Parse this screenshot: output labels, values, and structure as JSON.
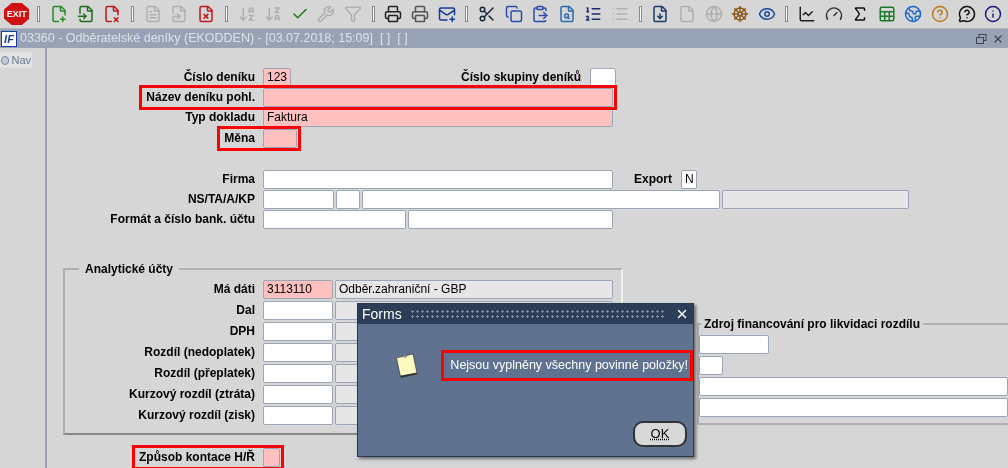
{
  "toolbar": [
    {
      "kind": "exit",
      "label": "EXIT",
      "disabled": false
    },
    {
      "kind": "separator"
    },
    {
      "kind": "button",
      "disabled": false
    },
    {
      "kind": "button",
      "disabled": false
    },
    {
      "kind": "button",
      "disabled": false
    },
    {
      "kind": "separator"
    },
    {
      "kind": "button",
      "disabled": true
    },
    {
      "kind": "button",
      "disabled": true
    },
    {
      "kind": "button",
      "disabled": false
    },
    {
      "kind": "separator"
    },
    {
      "kind": "button",
      "disabled": true
    },
    {
      "kind": "button",
      "disabled": true
    },
    {
      "kind": "button",
      "disabled": false
    },
    {
      "kind": "button",
      "disabled": true
    },
    {
      "kind": "button",
      "disabled": true
    },
    {
      "kind": "separator"
    },
    {
      "kind": "button",
      "disabled": false
    },
    {
      "kind": "button",
      "disabled": false
    },
    {
      "kind": "button",
      "disabled": false
    },
    {
      "kind": "separator"
    },
    {
      "kind": "button",
      "disabled": false
    },
    {
      "kind": "button",
      "disabled": false
    },
    {
      "kind": "button",
      "disabled": false
    },
    {
      "kind": "button",
      "disabled": false
    },
    {
      "kind": "button",
      "disabled": false
    },
    {
      "kind": "button",
      "disabled": true
    },
    {
      "kind": "separator"
    },
    {
      "kind": "button",
      "disabled": false
    },
    {
      "kind": "button",
      "disabled": true
    },
    {
      "kind": "button",
      "disabled": true
    },
    {
      "kind": "button",
      "disabled": false
    },
    {
      "kind": "button",
      "disabled": false
    },
    {
      "kind": "separator"
    },
    {
      "kind": "button",
      "disabled": false
    },
    {
      "kind": "button",
      "disabled": false
    },
    {
      "kind": "button",
      "disabled": false
    },
    {
      "kind": "button",
      "disabled": false
    },
    {
      "kind": "button",
      "disabled": false
    },
    {
      "kind": "button",
      "disabled": false
    },
    {
      "kind": "button",
      "disabled": false
    },
    {
      "kind": "button",
      "disabled": false
    }
  ],
  "window": {
    "logo": "IF",
    "title": "03360 - Odběratelské deníky (EKODDEN) - [03.07.2018; 15:09]  [ ]  [ ]"
  },
  "nav": {
    "label": "Nav"
  },
  "header_rows": [
    {
      "label": "Číslo deníku",
      "highlighted": false,
      "fields": [
        {
          "kind": "required",
          "value": "123"
        }
      ],
      "side": {
        "label": "Číslo skupiny deníků",
        "fields": [
          {
            "kind": "normal"
          }
        ]
      }
    },
    {
      "label": "Název deníku pohl.",
      "highlighted": true,
      "fields": [
        {
          "kind": "required"
        }
      ]
    },
    {
      "label": "Typ dokladu",
      "highlighted": false,
      "fields": [
        {
          "kind": "required",
          "value": "Faktura"
        }
      ]
    },
    {
      "label": "Měna",
      "highlighted": true,
      "fields": [
        {
          "kind": "required"
        }
      ]
    }
  ],
  "detail_rows": [
    {
      "label": "Firma",
      "highlighted": false,
      "fields": [
        {
          "kind": "normal"
        }
      ],
      "side": {
        "label": "Export",
        "fields": [
          {
            "kind": "normal",
            "value": "N"
          }
        ]
      }
    },
    {
      "label": "NS/TA/A/KP",
      "highlighted": false,
      "fields": [
        {
          "kind": "normal"
        },
        {
          "kind": "normal"
        },
        {
          "kind": "normal"
        },
        {
          "kind": "readonly"
        }
      ]
    },
    {
      "label": "Formát a číslo bank. účtu",
      "highlighted": false,
      "fields": [
        {
          "kind": "normal"
        },
        {
          "kind": "normal"
        }
      ]
    }
  ],
  "accounts": {
    "title": "Analytické účty",
    "rows": [
      {
        "label": "Má dáti",
        "highlighted": false,
        "fields": [
          {
            "kind": "required",
            "value": "3113110"
          },
          {
            "kind": "readonly",
            "value": "Odběr.zahraniční - GBP"
          }
        ]
      },
      {
        "label": "Dal",
        "highlighted": false,
        "fields": [
          {
            "kind": "normal"
          },
          {
            "kind": "readonly"
          }
        ]
      },
      {
        "label": "DPH",
        "highlighted": false,
        "fields": [
          {
            "kind": "normal"
          },
          {
            "kind": "readonly"
          }
        ]
      },
      {
        "label": "Rozdíl (nedoplatek)",
        "highlighted": false,
        "fields": [
          {
            "kind": "normal"
          },
          {
            "kind": "readonly"
          }
        ]
      },
      {
        "label": "Rozdíl (přeplatek)",
        "highlighted": false,
        "fields": [
          {
            "kind": "normal"
          },
          {
            "kind": "readonly"
          }
        ]
      },
      {
        "label": "Kurzový rozdíl (ztráta)",
        "highlighted": false,
        "fields": [
          {
            "kind": "normal"
          },
          {
            "kind": "readonly"
          }
        ]
      },
      {
        "label": "Kurzový rozdíl (zisk)",
        "highlighted": false,
        "fields": [
          {
            "kind": "normal"
          },
          {
            "kind": "readonly"
          }
        ]
      }
    ]
  },
  "funding": {
    "title": "Zdroj financování pro likvidaci rozdílu",
    "fields": [
      {
        "kind": "normal"
      },
      {
        "kind": "normal"
      },
      {
        "kind": "normal"
      },
      {
        "kind": "normal"
      }
    ]
  },
  "footer_rows": [
    {
      "label": "Způsob kontace H/Ř",
      "highlighted": true,
      "fields": [
        {
          "kind": "required"
        }
      ]
    }
  ],
  "dialog": {
    "title": "Forms",
    "message": "Nejsou vyplněny všechny povinné položky!",
    "message_highlighted": true,
    "button": "OK"
  }
}
